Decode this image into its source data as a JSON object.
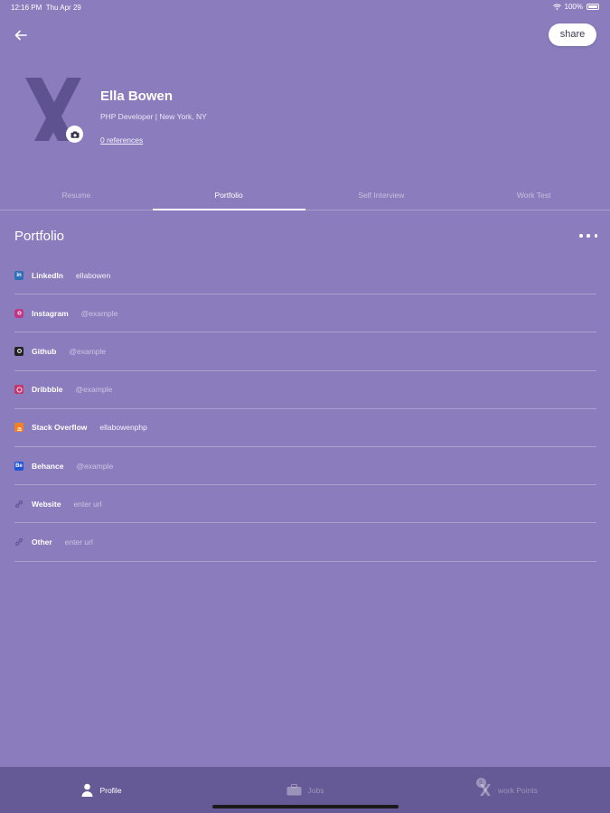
{
  "status": {
    "time": "12:16 PM",
    "date": "Thu Apr 29",
    "battery": "100%"
  },
  "header": {
    "share_label": "share"
  },
  "profile": {
    "name": "Ella Bowen",
    "subtitle": "PHP Developer | New York, NY",
    "references": "0 references"
  },
  "tabs": [
    {
      "label": "Resume",
      "active": false
    },
    {
      "label": "Portfolio",
      "active": true
    },
    {
      "label": "Self Interview",
      "active": false
    },
    {
      "label": "Work Test",
      "active": false
    }
  ],
  "portfolio": {
    "title": "Portfolio",
    "items": [
      {
        "label": "LinkedIn",
        "value": "ellabowen",
        "filled": true,
        "icon": "linkedin-icon",
        "color": "#2f6fb5"
      },
      {
        "label": "Instagram",
        "value": "@example",
        "filled": false,
        "icon": "instagram-icon",
        "color": "#c13584"
      },
      {
        "label": "Github",
        "value": "@example",
        "filled": false,
        "icon": "github-icon",
        "color": "#222222"
      },
      {
        "label": "Dribbble",
        "value": "@example",
        "filled": false,
        "icon": "dribbble-icon",
        "color": "#c2386d"
      },
      {
        "label": "Stack Overflow",
        "value": "ellabowenphp",
        "filled": true,
        "icon": "stackoverflow-icon",
        "color": "#f48024"
      },
      {
        "label": "Behance",
        "value": "@example",
        "filled": false,
        "icon": "behance-icon",
        "color": "#1f56d6"
      },
      {
        "label": "Website",
        "value": "enter url",
        "filled": false,
        "icon": "link-icon",
        "color": "#6b5fa3"
      },
      {
        "label": "Other",
        "value": "enter url",
        "filled": false,
        "icon": "link-icon",
        "color": "#6b5fa3"
      }
    ]
  },
  "bottom_nav": {
    "profile": "Profile",
    "jobs": "Jobs",
    "work_points": "work Points",
    "work_points_badge": "5"
  },
  "colors": {
    "background": "#8b7dbd",
    "nav_background": "#655a95",
    "avatar_x": "#5e5290"
  }
}
